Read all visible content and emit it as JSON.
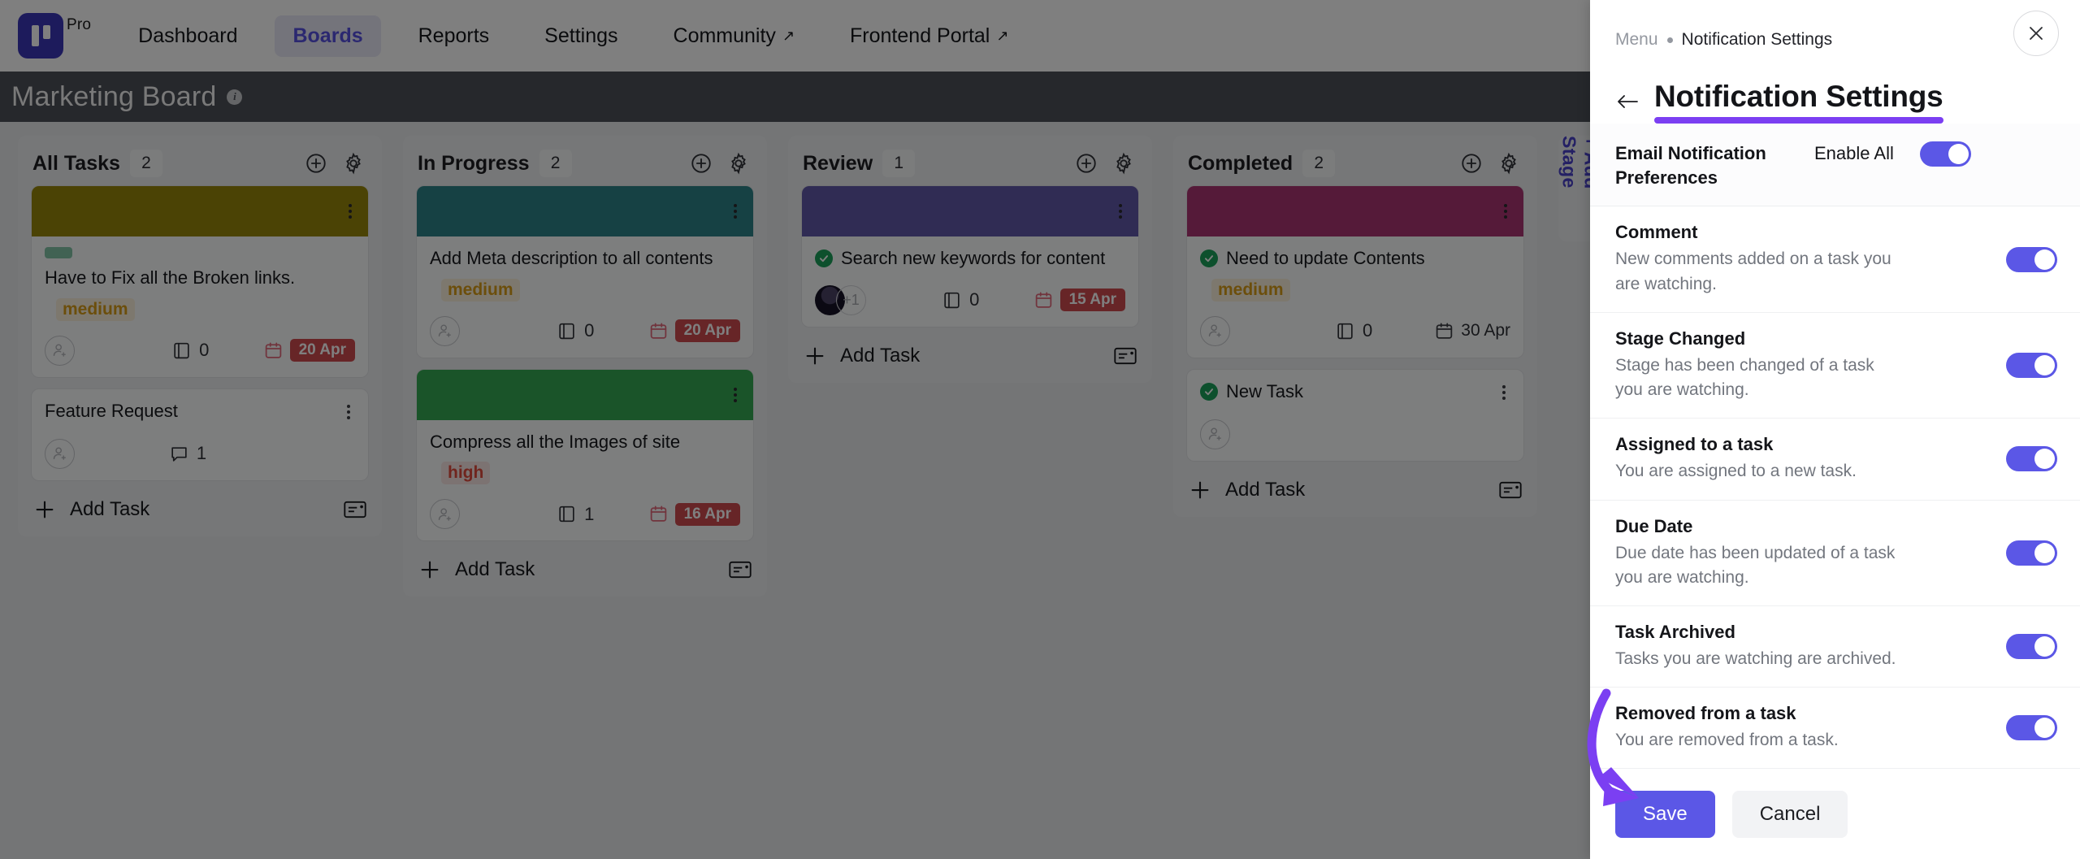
{
  "nav": {
    "brand_label": "Pro",
    "links": [
      {
        "label": "Dashboard",
        "external": false,
        "active": false
      },
      {
        "label": "Boards",
        "external": false,
        "active": true
      },
      {
        "label": "Reports",
        "external": false,
        "active": false
      },
      {
        "label": "Settings",
        "external": false,
        "active": false
      },
      {
        "label": "Community",
        "external": true,
        "active": false
      },
      {
        "label": "Frontend Portal",
        "external": true,
        "active": false
      }
    ],
    "external_glyph": "↗"
  },
  "board": {
    "title": "Marketing Board",
    "add_stage_label": "+ Add Stage",
    "add_task_label": "Add Task",
    "columns": [
      {
        "title": "All Tasks",
        "count": "2",
        "cards": [
          {
            "cover_color": "#97870a",
            "has_cover": true,
            "has_tag": true,
            "tag_color": "#82c4a7",
            "title": "Have to Fix all the Broken links.",
            "completed": false,
            "priority": "medium",
            "priority_class": "medium",
            "assignees": "none",
            "count_icon": "book-icon",
            "count_value": "0",
            "due": "20 Apr",
            "due_style": "pill"
          },
          {
            "cover_color": "",
            "has_cover": false,
            "has_tag": false,
            "title": "Feature Request",
            "completed": false,
            "priority": "",
            "assignees": "none",
            "count_icon": "comment-icon",
            "count_value": "1",
            "due": "",
            "due_style": "none"
          }
        ]
      },
      {
        "title": "In Progress",
        "count": "2",
        "cards": [
          {
            "cover_color": "#2d8289",
            "has_cover": true,
            "has_tag": false,
            "title": "Add Meta description to all contents",
            "completed": false,
            "priority": "medium",
            "priority_class": "medium",
            "assignees": "none",
            "count_icon": "book-icon",
            "count_value": "0",
            "due": "20 Apr",
            "due_style": "pill"
          },
          {
            "cover_color": "#35a853",
            "has_cover": true,
            "has_tag": false,
            "title": "Compress all the Images of site",
            "completed": false,
            "priority": "high",
            "priority_class": "high",
            "assignees": "none",
            "count_icon": "book-icon",
            "count_value": "1",
            "due": "16 Apr",
            "due_style": "pill"
          }
        ]
      },
      {
        "title": "Review",
        "count": "1",
        "cards": [
          {
            "cover_color": "#6158a8",
            "has_cover": true,
            "has_tag": false,
            "title": "Search new keywords for content",
            "completed": true,
            "priority": "",
            "assignees": "photo_plus_one",
            "assignee_more": "+1",
            "count_icon": "book-icon",
            "count_value": "0",
            "due": "15 Apr",
            "due_style": "pill"
          }
        ]
      },
      {
        "title": "Completed",
        "count": "2",
        "cards": [
          {
            "cover_color": "#aa3472",
            "has_cover": true,
            "has_tag": false,
            "title": "Need to update Contents",
            "completed": true,
            "priority": "medium",
            "priority_class": "medium",
            "assignees": "none",
            "count_icon": "book-icon",
            "count_value": "0",
            "due": "30 Apr",
            "due_style": "plain"
          },
          {
            "cover_color": "",
            "has_cover": false,
            "has_tag": false,
            "title": "New Task",
            "completed": true,
            "priority": "",
            "assignees": "none",
            "count_icon": "",
            "count_value": "",
            "due": "",
            "due_style": "none"
          }
        ]
      }
    ]
  },
  "panel": {
    "breadcrumb_root": "Menu",
    "breadcrumb_current": "Notification Settings",
    "title": "Notification Settings",
    "accent_color": "#7b3ff2",
    "toggle_on_color": "#5b57e6",
    "preferences_header": {
      "title": "Email Notification Preferences",
      "enable_label": "Enable All",
      "enabled": true
    },
    "settings": [
      {
        "name": "Comment",
        "desc": "New comments added on a task you are watching.",
        "enabled": true
      },
      {
        "name": "Stage Changed",
        "desc": "Stage has been changed of a task you are watching.",
        "enabled": true
      },
      {
        "name": "Assigned to a task",
        "desc": "You are assigned to a new task.",
        "enabled": true
      },
      {
        "name": "Due Date",
        "desc": "Due date has been updated of a task you are watching.",
        "enabled": true
      },
      {
        "name": "Task Archived",
        "desc": "Tasks you are watching are archived.",
        "enabled": true
      },
      {
        "name": "Removed from a task",
        "desc": "You are removed from a task.",
        "enabled": true
      }
    ],
    "save_label": "Save",
    "cancel_label": "Cancel"
  }
}
